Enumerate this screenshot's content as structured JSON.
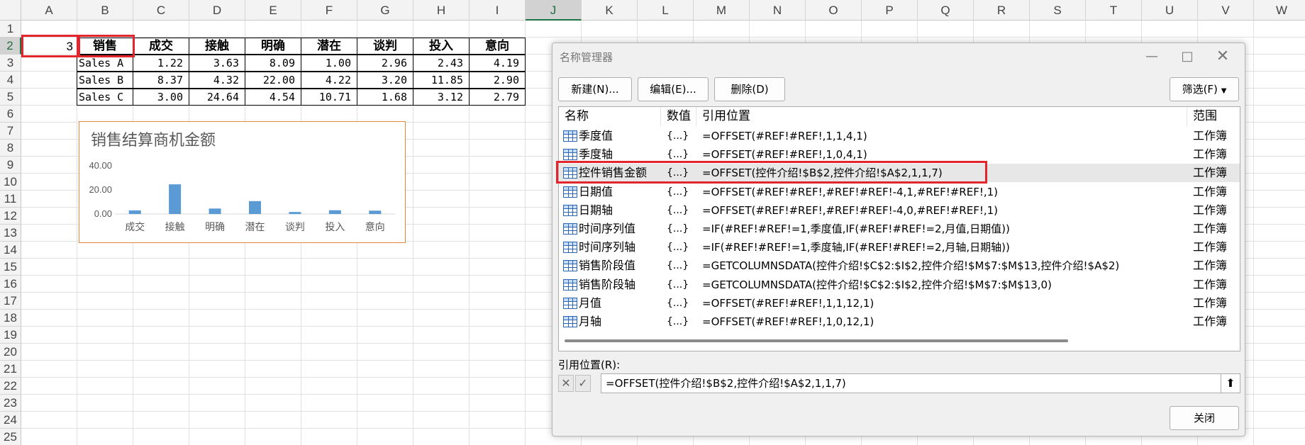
{
  "sheet": {
    "columns": [
      "A",
      "B",
      "C",
      "D",
      "E",
      "F",
      "G",
      "H",
      "I",
      "J",
      "K",
      "L",
      "M",
      "N",
      "O",
      "P",
      "Q",
      "R",
      "S",
      "T",
      "U",
      "V",
      "W"
    ],
    "selected_column": "J",
    "rows": [
      "1",
      "2",
      "3",
      "4",
      "5",
      "6",
      "7",
      "8",
      "9",
      "10",
      "11",
      "12",
      "13",
      "14",
      "15",
      "16",
      "17",
      "18",
      "19",
      "20",
      "21",
      "22",
      "23",
      "24",
      "25"
    ],
    "selected_row": "2",
    "a2_value": "3",
    "table": {
      "headers": [
        "销售",
        "成交",
        "接触",
        "明确",
        "潜在",
        "谈判",
        "投入",
        "意向"
      ],
      "rows": [
        {
          "label": "Sales A",
          "values": [
            "1.22",
            "3.63",
            "8.09",
            "1.00",
            "2.96",
            "2.43",
            "4.19"
          ]
        },
        {
          "label": "Sales B",
          "values": [
            "8.37",
            "4.32",
            "22.00",
            "4.22",
            "3.20",
            "11.85",
            "2.90"
          ]
        },
        {
          "label": "Sales C",
          "values": [
            "3.00",
            "24.64",
            "4.54",
            "10.71",
            "1.68",
            "3.12",
            "2.79"
          ]
        }
      ]
    }
  },
  "chart_data": {
    "type": "bar",
    "title": "销售结算商机金额",
    "categories": [
      "成交",
      "接触",
      "明确",
      "潜在",
      "谈判",
      "投入",
      "意向"
    ],
    "values": [
      3.0,
      24.64,
      4.54,
      10.71,
      1.68,
      3.12,
      2.79
    ],
    "ylim": [
      0,
      40
    ],
    "yticks": [
      "40.00",
      "20.00",
      "0.00"
    ],
    "bar_color": "#5b9bd5",
    "border_color": "#e3893b",
    "grid": false,
    "legend": "none"
  },
  "dialog": {
    "title": "名称管理器",
    "buttons": {
      "new": "新建(N)...",
      "edit": "编辑(E)...",
      "delete": "删除(D)",
      "filter": "筛选(F)",
      "close": "关闭"
    },
    "columns": {
      "name": "名称",
      "value": "数值",
      "refers_to": "引用位置",
      "scope": "范围"
    },
    "items": [
      {
        "name": "季度值",
        "value": "{...}",
        "refers_to": "=OFFSET(#REF!#REF!,1,1,4,1)",
        "scope": "工作簿"
      },
      {
        "name": "季度轴",
        "value": "{...}",
        "refers_to": "=OFFSET(#REF!#REF!,1,0,4,1)",
        "scope": "工作簿"
      },
      {
        "name": "控件销售金额",
        "value": "{...}",
        "refers_to": "=OFFSET(控件介绍!$B$2,控件介绍!$A$2,1,1,7)",
        "scope": "工作簿"
      },
      {
        "name": "日期值",
        "value": "{...}",
        "refers_to": "=OFFSET(#REF!#REF!,#REF!#REF!-4,1,#REF!#REF!,1)",
        "scope": "工作簿"
      },
      {
        "name": "日期轴",
        "value": "{...}",
        "refers_to": "=OFFSET(#REF!#REF!,#REF!#REF!-4,0,#REF!#REF!,1)",
        "scope": "工作簿"
      },
      {
        "name": "时间序列值",
        "value": "{...}",
        "refers_to": "=IF(#REF!#REF!=1,季度值,IF(#REF!#REF!=2,月值,日期值))",
        "scope": "工作簿"
      },
      {
        "name": "时间序列轴",
        "value": "{...}",
        "refers_to": "=IF(#REF!#REF!=1,季度轴,IF(#REF!#REF!=2,月轴,日期轴))",
        "scope": "工作簿"
      },
      {
        "name": "销售阶段值",
        "value": "{...}",
        "refers_to": "=GETCOLUMNSDATA(控件介绍!$C$2:$I$2,控件介绍!$M$7:$M$13,控件介绍!$A$2)",
        "scope": "工作簿"
      },
      {
        "name": "销售阶段轴",
        "value": "{...}",
        "refers_to": "=GETCOLUMNSDATA(控件介绍!$C$2:$I$2,控件介绍!$M$7:$M$13,0)",
        "scope": "工作簿"
      },
      {
        "name": "月值",
        "value": "{...}",
        "refers_to": "=OFFSET(#REF!#REF!,1,1,12,1)",
        "scope": "工作簿"
      },
      {
        "name": "月轴",
        "value": "{...}",
        "refers_to": "=OFFSET(#REF!#REF!,1,0,12,1)",
        "scope": "工作簿"
      }
    ],
    "selected_index": 2,
    "ref_label": "引用位置(R):",
    "ref_value": "=OFFSET(控件介绍!$B$2,控件介绍!$A$2,1,1,7)",
    "icons": {
      "minimize": "minimize-icon",
      "maximize": "maximize-icon",
      "close": "close-icon",
      "cancel": "cross-icon",
      "confirm": "check-icon",
      "collapse": "upload-arrow-icon",
      "table": "table-icon"
    }
  }
}
